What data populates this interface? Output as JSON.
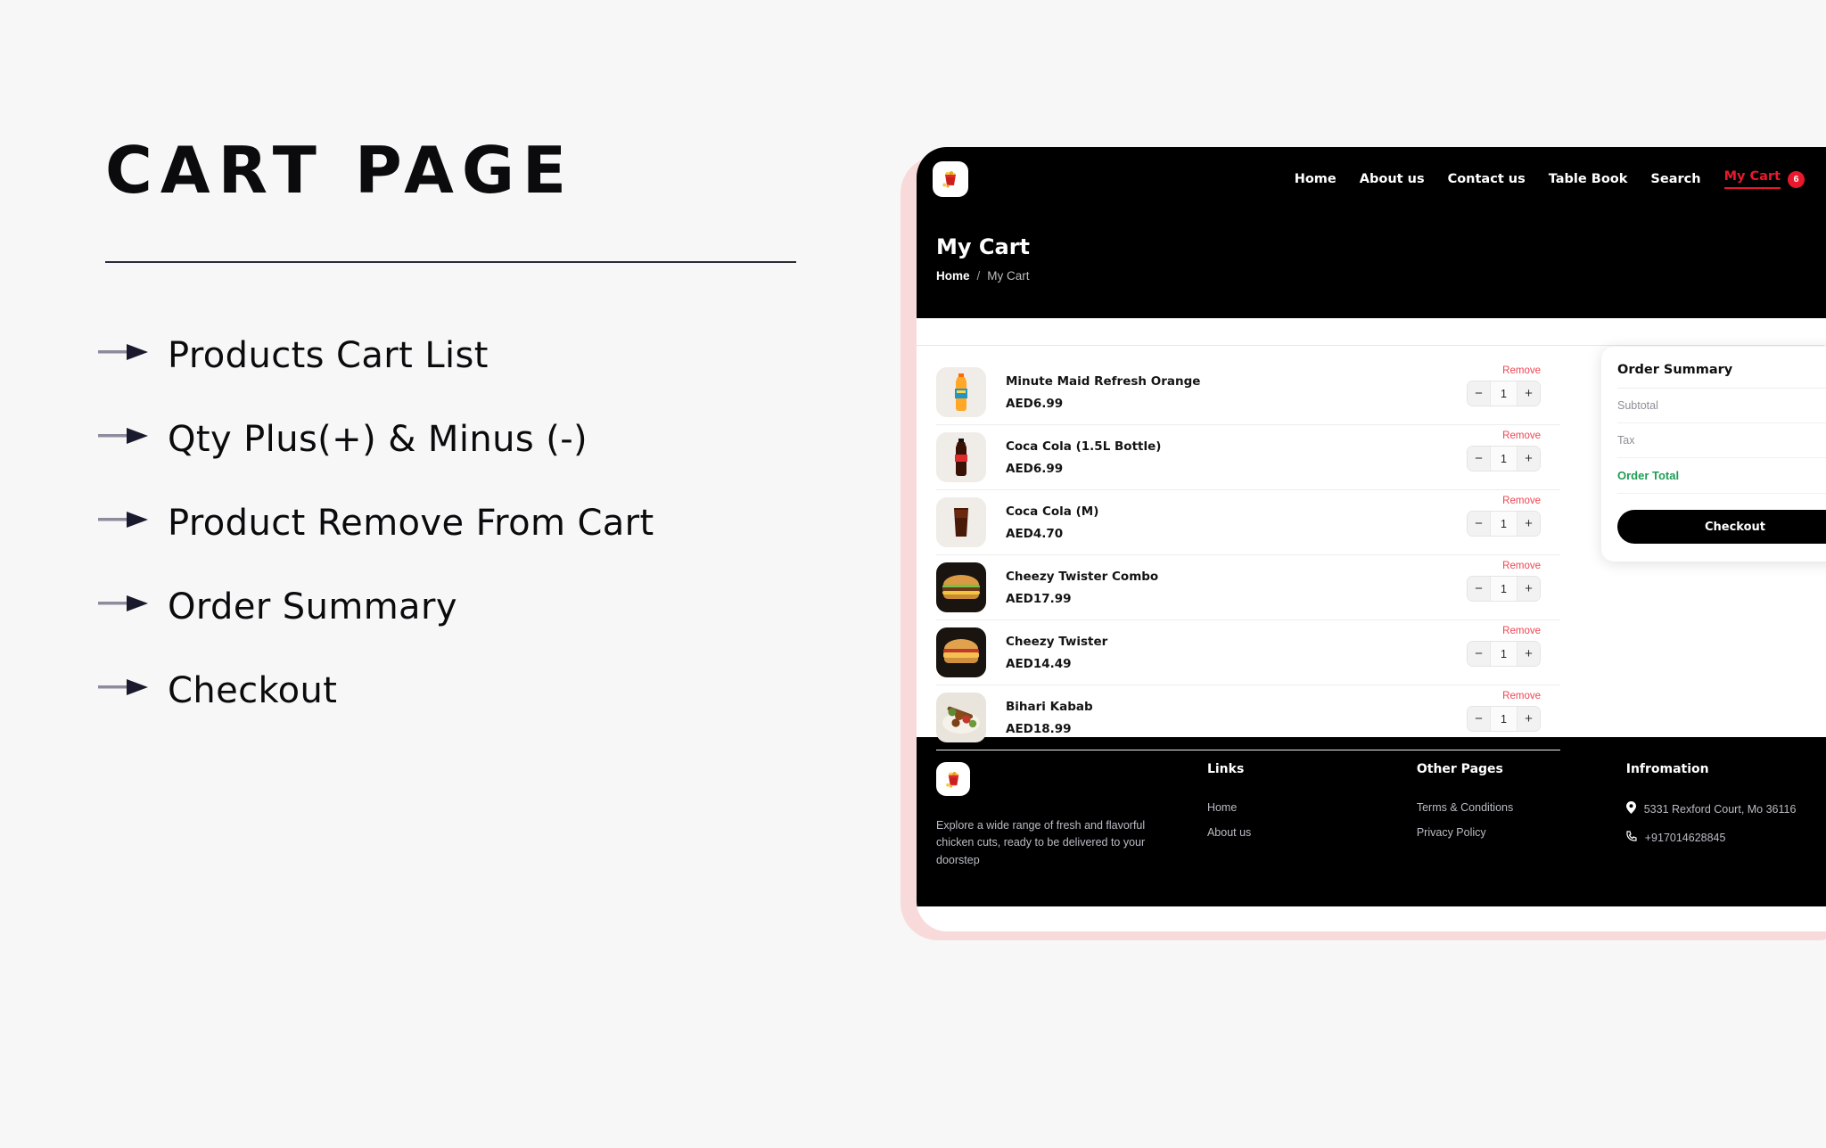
{
  "left_panel": {
    "title": "CART PAGE",
    "features": [
      {
        "label": "Products Cart List",
        "icon": "arrow-right-icon"
      },
      {
        "label": "Qty Plus(+) & Minus (-)",
        "icon": "arrow-right-icon"
      },
      {
        "label": "Product Remove From Cart",
        "icon": "arrow-right-icon"
      },
      {
        "label": "Order Summary",
        "icon": "arrow-right-icon"
      },
      {
        "label": "Checkout",
        "icon": "arrow-right-icon"
      }
    ]
  },
  "colors": {
    "accent_red": "#e8192c",
    "remove_red": "#ef4452",
    "total_green": "#1f9d55",
    "frame_pink": "#f9dada",
    "page_bg": "#f7f7f7",
    "dark": "#000000"
  },
  "mockup": {
    "nav": {
      "logo_icon": "chicken-bucket-logo-icon",
      "links": [
        {
          "label": "Home",
          "active": false
        },
        {
          "label": "About us",
          "active": false
        },
        {
          "label": "Contact us",
          "active": false
        },
        {
          "label": "Table Book",
          "active": false
        },
        {
          "label": "Search",
          "active": false
        }
      ],
      "cart": {
        "label": "My Cart",
        "badge": "6"
      },
      "flag_icon": "us-flag-icon"
    },
    "hero": {
      "title": "My Cart",
      "breadcrumb": {
        "home": "Home",
        "separator": "/",
        "current": "My Cart"
      }
    },
    "cart": {
      "items": [
        {
          "name": "Minute Maid Refresh Orange",
          "price": "AED6.99",
          "qty": "1",
          "remove": "Remove",
          "minus": "−",
          "plus": "+",
          "thumb_icon": "orange-juice-bottle-icon"
        },
        {
          "name": "Coca Cola (1.5L Bottle)",
          "price": "AED6.99",
          "qty": "1",
          "remove": "Remove",
          "minus": "−",
          "plus": "+",
          "thumb_icon": "cola-bottle-icon"
        },
        {
          "name": "Coca Cola (M)",
          "price": "AED4.70",
          "qty": "1",
          "remove": "Remove",
          "minus": "−",
          "plus": "+",
          "thumb_icon": "cola-glass-icon"
        },
        {
          "name": "Cheezy Twister Combo",
          "price": "AED17.99",
          "qty": "1",
          "remove": "Remove",
          "minus": "−",
          "plus": "+",
          "thumb_icon": "burger-icon"
        },
        {
          "name": "Cheezy Twister",
          "price": "AED14.49",
          "qty": "1",
          "remove": "Remove",
          "minus": "−",
          "plus": "+",
          "thumb_icon": "burger-icon"
        },
        {
          "name": "Bihari Kabab",
          "price": "AED18.99",
          "qty": "1",
          "remove": "Remove",
          "minus": "−",
          "plus": "+",
          "thumb_icon": "kabab-skewer-icon"
        }
      ]
    },
    "order_summary": {
      "title": "Order Summary",
      "rows": [
        {
          "label": "Subtotal",
          "value": ""
        },
        {
          "label": "Tax",
          "value": ""
        }
      ],
      "total_label": "Order Total",
      "total_value": "",
      "checkout_label": "Checkout"
    },
    "footer": {
      "logo_icon": "chicken-bucket-logo-icon",
      "tagline": "Explore a wide range of fresh and flavorful chicken cuts, ready to be delivered to your doorstep",
      "links_title": "Links",
      "links": [
        "Home",
        "About us"
      ],
      "other_title": "Other Pages",
      "other_links": [
        "Terms & Conditions",
        "Privacy Policy"
      ],
      "info_title": "Infromation",
      "info_address": "5331 Rexford Court, Mo 36116",
      "info_phone": "+917014628845"
    }
  }
}
